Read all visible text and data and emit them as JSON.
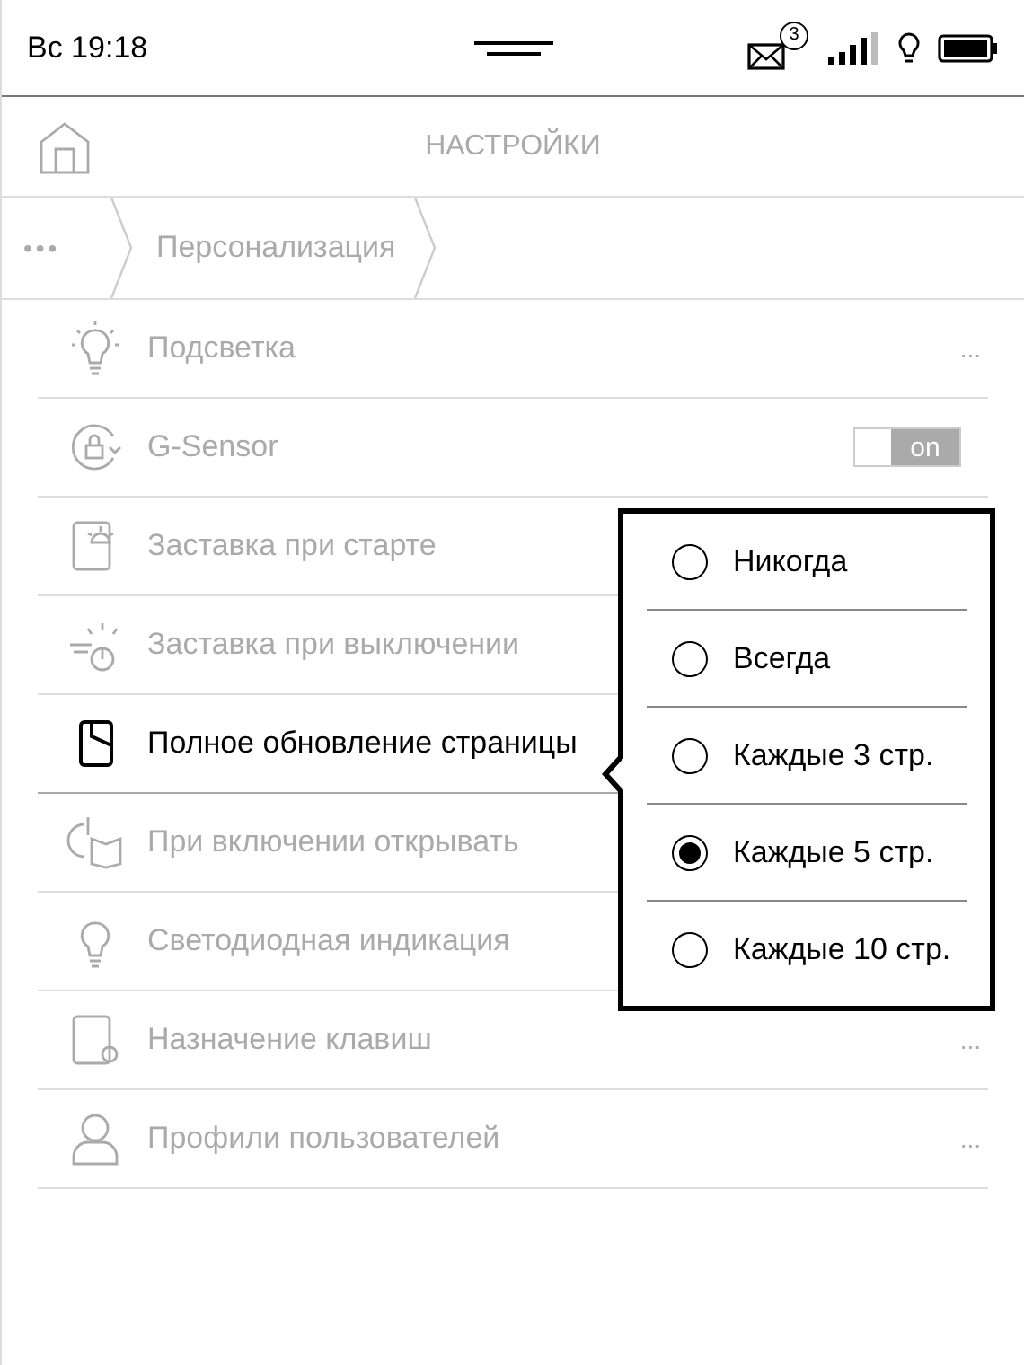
{
  "status_bar": {
    "time": "Вс 19:18",
    "mail_badge": "3"
  },
  "header": {
    "title": "НАСТРОЙКИ"
  },
  "breadcrumb": {
    "more": "•••",
    "items": [
      "Персонализация"
    ]
  },
  "rows": [
    {
      "label": "Подсветка",
      "selected": false,
      "kind": "more",
      "more": "..."
    },
    {
      "label": "G-Sensor",
      "selected": false,
      "kind": "toggle",
      "on": true,
      "toggle_label": "on"
    },
    {
      "label": "Заставка при старте",
      "selected": false,
      "kind": "plain"
    },
    {
      "label": "Заставка при выключении",
      "selected": false,
      "kind": "plain"
    },
    {
      "label": "Полное обновление страницы",
      "selected": true,
      "kind": "plain"
    },
    {
      "label": "При включении открывать",
      "selected": false,
      "kind": "plain"
    },
    {
      "label": "Светодиодная индикация",
      "selected": false,
      "kind": "plain"
    },
    {
      "label": "Назначение клавиш",
      "selected": false,
      "kind": "more",
      "more": "..."
    },
    {
      "label": "Профили пользователей",
      "selected": false,
      "kind": "more",
      "more": "..."
    }
  ],
  "popup": {
    "options": [
      {
        "label": "Никогда",
        "selected": false
      },
      {
        "label": "Всегда",
        "selected": false
      },
      {
        "label": "Каждые 3 стр.",
        "selected": false
      },
      {
        "label": "Каждые 5 стр.",
        "selected": true
      },
      {
        "label": "Каждые 10 стр.",
        "selected": false
      }
    ]
  }
}
